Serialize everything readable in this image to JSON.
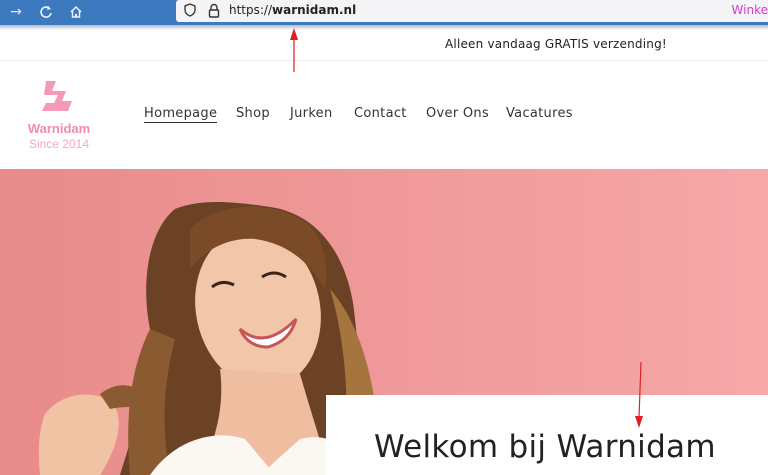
{
  "browser": {
    "url_prefix": "https://",
    "url_domain": "warnidam.nl",
    "right_link": "Winke",
    "icons": [
      "forward-arrow-icon",
      "reload-icon",
      "home-icon",
      "shield-icon",
      "lock-icon"
    ]
  },
  "announcement": {
    "text": "Alleen vandaag GRATIS verzending!"
  },
  "logo": {
    "brand": "Warnidam",
    "since": "Since 2014",
    "color": "#f28aa8"
  },
  "nav": {
    "items": [
      {
        "label": "Homepage",
        "active": true
      },
      {
        "label": "Shop"
      },
      {
        "label": "Jurken"
      },
      {
        "label": "Contact"
      },
      {
        "label": "Over Ons"
      },
      {
        "label": "Vacatures"
      }
    ]
  },
  "hero": {
    "background": "#f09a9b",
    "heading": "Welkom bij Warnidam"
  },
  "annotation_color": "#e02020"
}
